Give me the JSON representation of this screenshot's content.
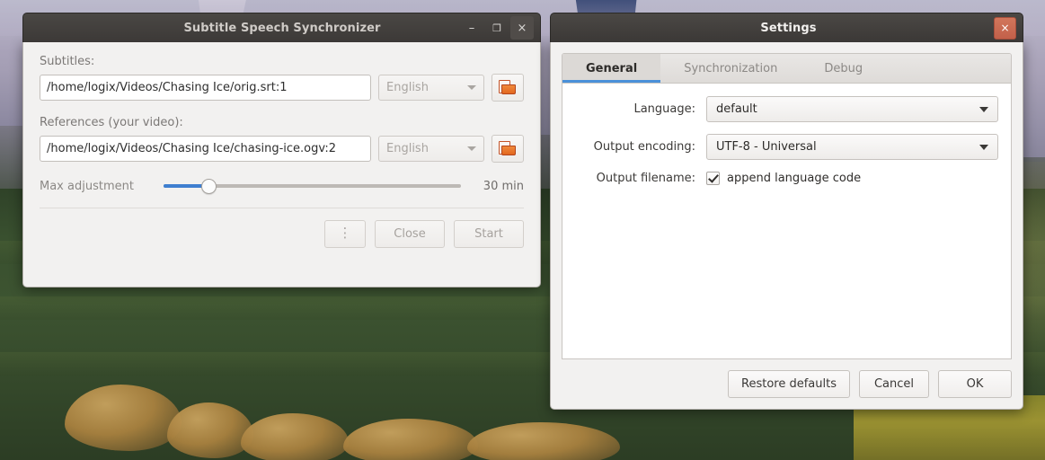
{
  "main_window": {
    "title": "Subtitle Speech Synchronizer",
    "titlebar_buttons": [
      {
        "name": "minimize",
        "glyph": "–"
      },
      {
        "name": "maximize",
        "glyph": "❐"
      },
      {
        "name": "close",
        "glyph": "×"
      }
    ],
    "subtitles": {
      "label": "Subtitles:",
      "value": "/home/logix/Videos/Chasing Ice/orig.srt:1",
      "placeholder": "",
      "language": "English",
      "browse_icon": "folder-open-icon"
    },
    "references": {
      "label": "References (your video):",
      "value": "/home/logix/Videos/Chasing Ice/chasing-ice.ogv:2",
      "placeholder": "",
      "language": "English",
      "browse_icon": "folder-open-icon"
    },
    "slider": {
      "label": "Max adjustment",
      "value_text": "30 min",
      "percent": 15
    },
    "actions": {
      "menu_glyph": "⋮",
      "close_label": "Close",
      "start_label": "Start"
    }
  },
  "settings_window": {
    "title": "Settings",
    "close_glyph": "×",
    "tabs": [
      {
        "label": "General",
        "active": true
      },
      {
        "label": "Synchronization",
        "active": false
      },
      {
        "label": "Debug",
        "active": false
      }
    ],
    "general": {
      "language": {
        "label": "Language:",
        "value": "default"
      },
      "output_encoding": {
        "label": "Output encoding:",
        "value": "UTF-8 - Universal"
      },
      "output_filename": {
        "label": "Output filename:",
        "checkbox_label": "append language code",
        "checked": true
      }
    },
    "actions": {
      "restore_label": "Restore defaults",
      "cancel_label": "Cancel",
      "ok_label": "OK"
    }
  },
  "colors": {
    "accent_blue": "#4a90d9",
    "slider_blue": "#3f7fd0",
    "close_red": "#c2604a",
    "folder_orange": "#e2671f",
    "window_bg": "#f2f1f0",
    "titlebar_bg": "#3c3937"
  }
}
